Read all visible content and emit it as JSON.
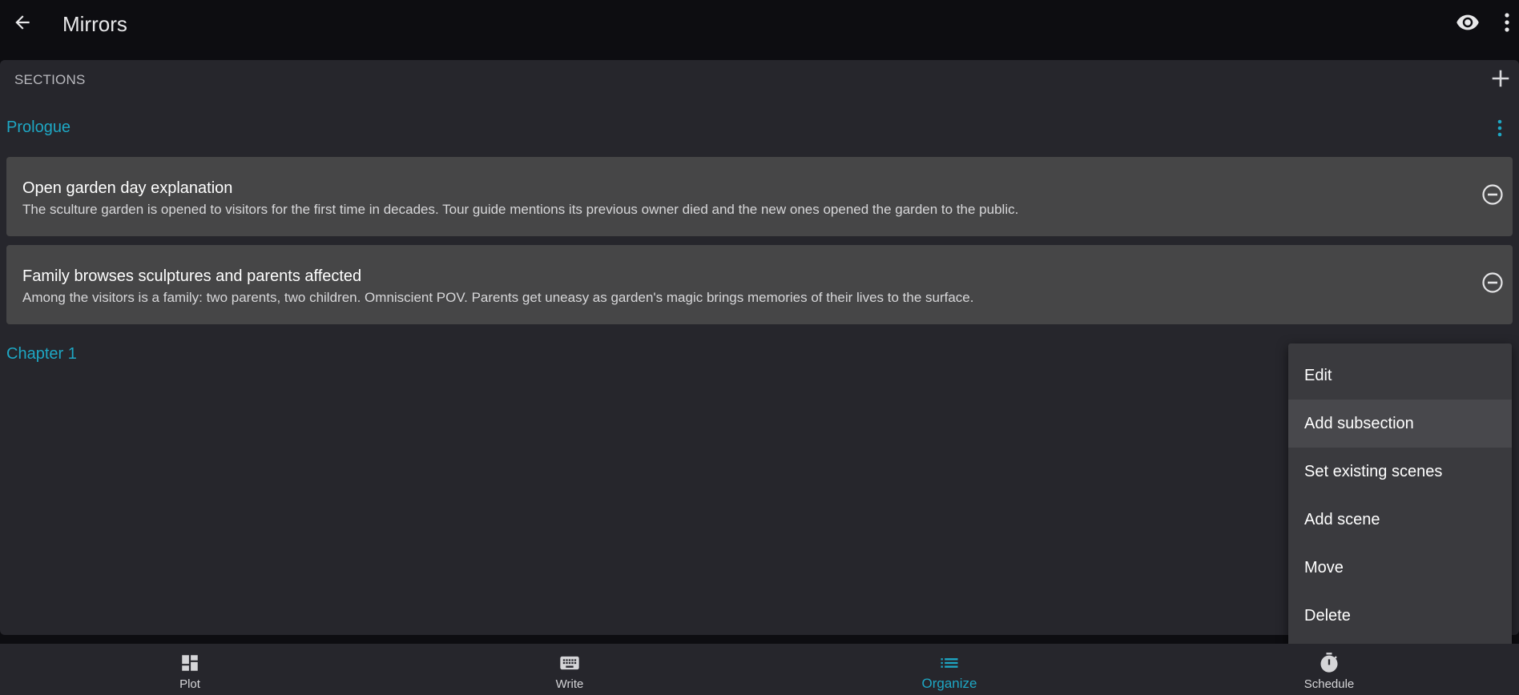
{
  "topbar": {
    "title": "Mirrors",
    "icons": {
      "back": "arrow-back-icon",
      "preview": "eye-icon",
      "more": "more-vert-icon"
    }
  },
  "sections": {
    "header": "SECTIONS",
    "add_icon": "plus-icon",
    "items": [
      {
        "title": "Prologue",
        "scenes": [
          {
            "title": "Open garden day explanation",
            "description": "The sculture garden is opened to visitors for the first time in decades. Tour guide mentions its previous owner died and the new ones opened the garden to the public."
          },
          {
            "title": "Family browses sculptures and parents affected",
            "description": "Among the visitors is a family: two parents, two children. Omniscient POV. Parents get uneasy as garden's magic brings memories of their lives to the surface."
          }
        ]
      },
      {
        "title": "Chapter 1",
        "scenes": []
      }
    ]
  },
  "context_menu": {
    "items": [
      "Edit",
      "Add subsection",
      "Set existing scenes",
      "Add scene",
      "Move",
      "Delete"
    ],
    "highlighted_index": 1
  },
  "bottom_nav": {
    "items": [
      {
        "label": "Plot",
        "icon": "dashboard-icon"
      },
      {
        "label": "Write",
        "icon": "keyboard-icon"
      },
      {
        "label": "Organize",
        "icon": "list-icon"
      },
      {
        "label": "Schedule",
        "icon": "timer-icon"
      }
    ],
    "active_index": 2
  },
  "colors": {
    "accent": "#1ea7c4",
    "background": "#0d0d11",
    "panel": "#26262c",
    "card": "#464647",
    "menu": "#3a3a3e"
  }
}
